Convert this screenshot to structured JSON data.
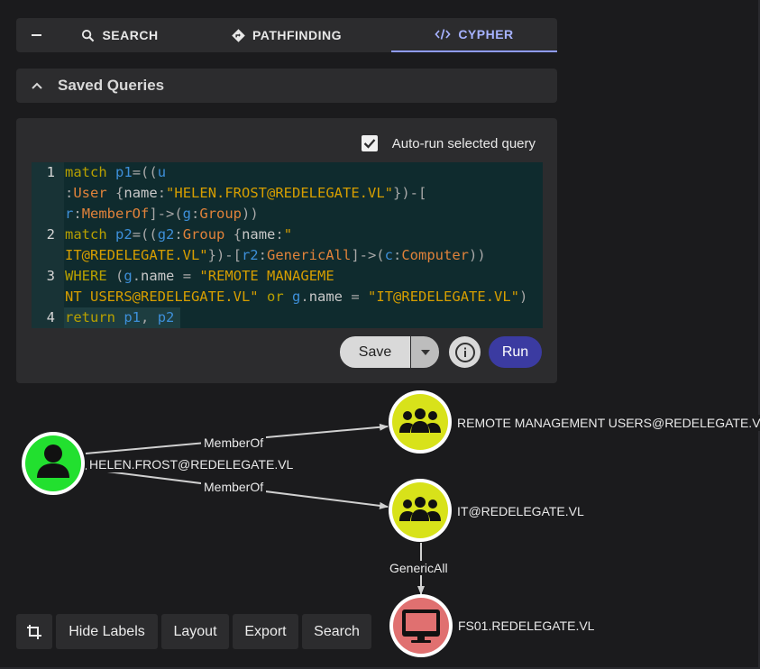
{
  "tabs": {
    "collapse_icon": "minus-icon",
    "search": "SEARCH",
    "pathfinding": "PATHFINDING",
    "cypher": "CYPHER",
    "active": "CYPHER",
    "accent": "#a6b2ff"
  },
  "saved_queries": {
    "label": "Saved Queries"
  },
  "editor": {
    "auto_run_label": "Auto-run selected query",
    "auto_run_checked": true,
    "line_numbers": [
      "1",
      "2",
      "3",
      "4"
    ],
    "lines": [
      "match p1=((u:User {name:\"HELEN.FROST@REDELEGATE.VL\"})-[r:MemberOf]->(g:Group))",
      "match p2=((g2:Group {name:\"IT@REDELEGATE.VL\"})-[r2:GenericAll]->(c:Computer))",
      "WHERE (g.name = \"REMOTE MANAGEMENT USERS@REDELEGATE.VL\" or g.name = \"IT@REDELEGATE.VL\")",
      "return p1, p2"
    ],
    "save_label": "Save",
    "run_label": "Run",
    "run_color": "#3b3ba1"
  },
  "graph": {
    "nodes": [
      {
        "label": "HELEN.FROST@REDELEGATE.VL",
        "kind": "user",
        "color": "#22e02f",
        "icon": "user-icon"
      },
      {
        "label": "REMOTE MANAGEMENT USERS@REDELEGATE.VL",
        "kind": "group",
        "color": "#d8e21a",
        "icon": "group-icon"
      },
      {
        "label": "IT@REDELEGATE.VL",
        "kind": "group",
        "color": "#d8e21a",
        "icon": "group-icon"
      },
      {
        "label": "FS01.REDELEGATE.VL",
        "kind": "computer",
        "color": "#e07070",
        "icon": "computer-icon"
      }
    ],
    "edges": [
      {
        "label": "MemberOf",
        "from": "HELEN.FROST@REDELEGATE.VL",
        "to": "REMOTE MANAGEMENT USERS@REDELEGATE.VL"
      },
      {
        "label": "MemberOf",
        "from": "HELEN.FROST@REDELEGATE.VL",
        "to": "IT@REDELEGATE.VL"
      },
      {
        "label": "GenericAll",
        "from": "IT@REDELEGATE.VL",
        "to": "FS01.REDELEGATE.VL"
      }
    ]
  },
  "toolbar": {
    "crop_icon": "crop-icon",
    "hide_labels": "Hide Labels",
    "layout": "Layout",
    "export": "Export",
    "search": "Search"
  }
}
